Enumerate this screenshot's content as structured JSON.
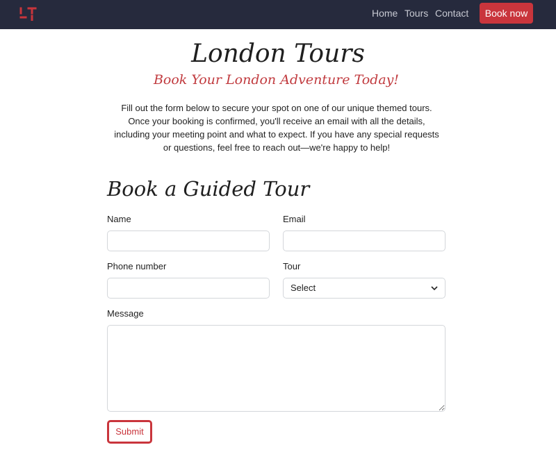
{
  "brand": {
    "logo_text": "LT",
    "accent_color": "#c9353c",
    "nav_bg": "#262a3d"
  },
  "nav": {
    "links": [
      "Home",
      "Tours",
      "Contact"
    ],
    "cta": "Book now"
  },
  "hero": {
    "title": "London Tours",
    "subtitle": "Book Your London Adventure Today!",
    "intro": "Fill out the form below to secure your spot on one of our unique themed tours. Once your booking is confirmed, you'll receive an email with all the details, including your meeting point and what to expect. If you have any special requests or questions, feel free to reach out—we're happy to help!"
  },
  "form": {
    "title": "Book a Guided Tour",
    "name_label": "Name",
    "name_value": "",
    "email_label": "Email",
    "email_value": "",
    "phone_label": "Phone number",
    "phone_value": "",
    "tour_label": "Tour",
    "tour_selected": "Select",
    "message_label": "Message",
    "message_value": "",
    "submit_label": "Submit"
  },
  "icons": {
    "select_icon": "chevron-down-icon"
  }
}
